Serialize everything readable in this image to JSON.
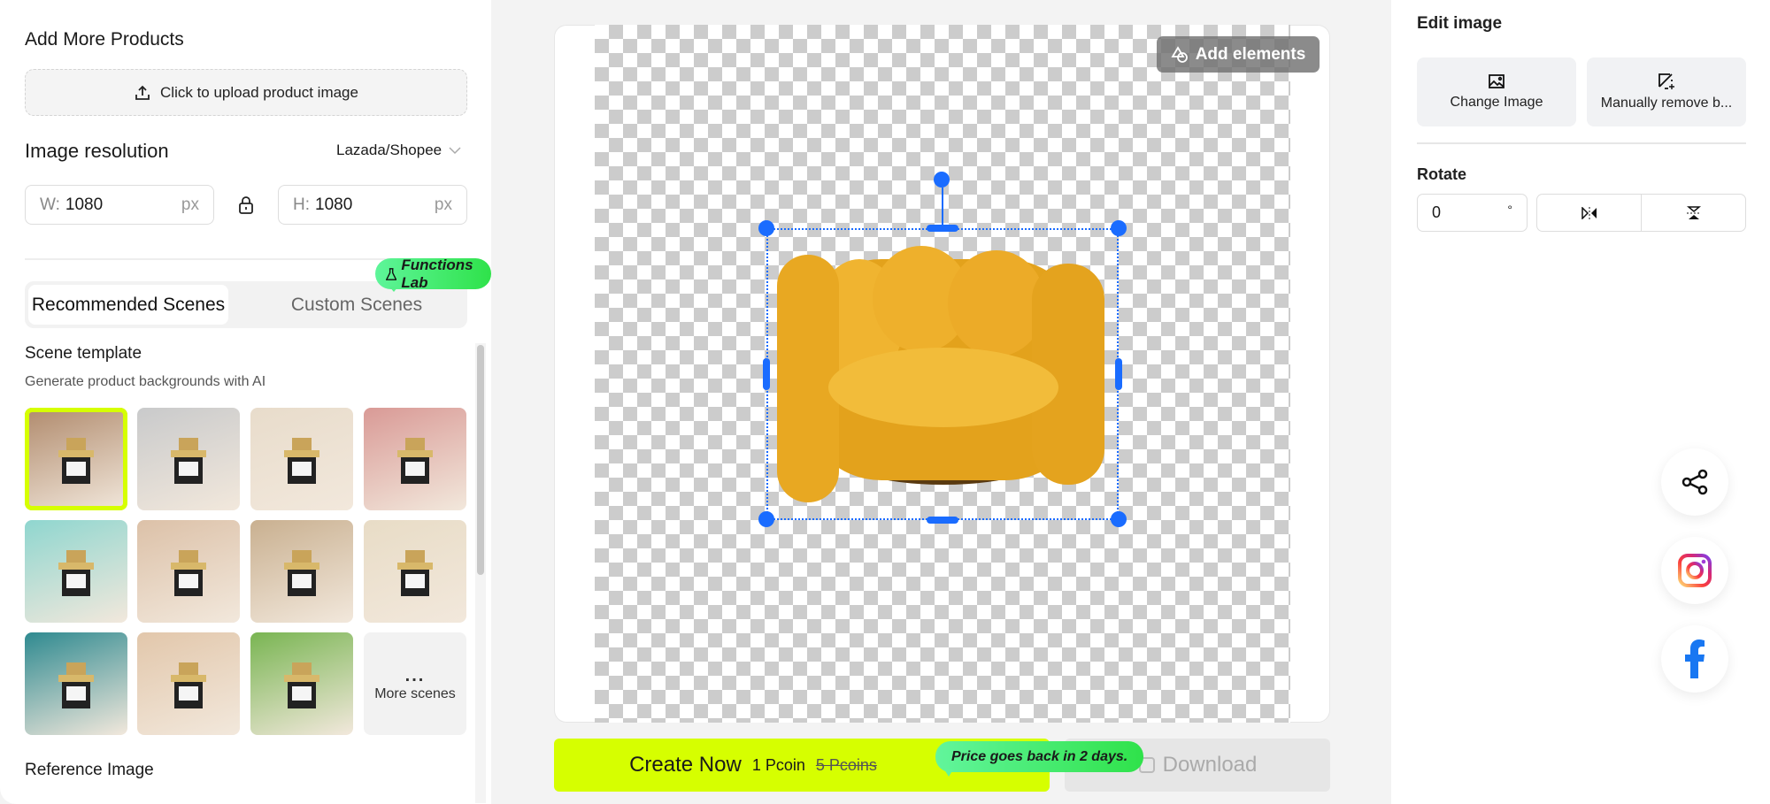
{
  "left": {
    "add_products_title": "Add More Products",
    "upload_label": "Click to upload product image",
    "resolution_title": "Image resolution",
    "platform": "Lazada/Shopee",
    "width_label": "W:",
    "width_value": "1080",
    "height_label": "H:",
    "height_value": "1080",
    "unit": "px",
    "tabs": [
      "Recommended Scenes",
      "Custom Scenes"
    ],
    "badge": "Functions Lab",
    "scene_title": "Scene template",
    "scene_subtitle": "Generate product backgrounds with AI",
    "more_dots": "...",
    "more_scenes": "More scenes",
    "reference_title": "Reference Image"
  },
  "thumbs": [
    "#b08a6c",
    "#c9cacb",
    "#e8dccb",
    "#d99a96",
    "#8fd6cf",
    "#dcc1a8",
    "#c9b090",
    "#e8dcc6",
    "#2f8a90",
    "#e2c7ab",
    "#79b552"
  ],
  "canvas": {
    "add_elements": "Add elements"
  },
  "actions": {
    "create": "Create Now",
    "price": "1 Pcoin",
    "old_price": "5 Pcoins",
    "tip": "Price goes back in 2 days.",
    "download": "Download"
  },
  "right": {
    "edit_title": "Edit image",
    "change_image": "Change Image",
    "remove_bg": "Manually remove b...",
    "rotate_title": "Rotate",
    "rotate_value": "0",
    "degree": "°"
  },
  "colors": {
    "accent": "#d6ff00",
    "handle": "#1a6cff",
    "facebook": "#1877f2"
  }
}
